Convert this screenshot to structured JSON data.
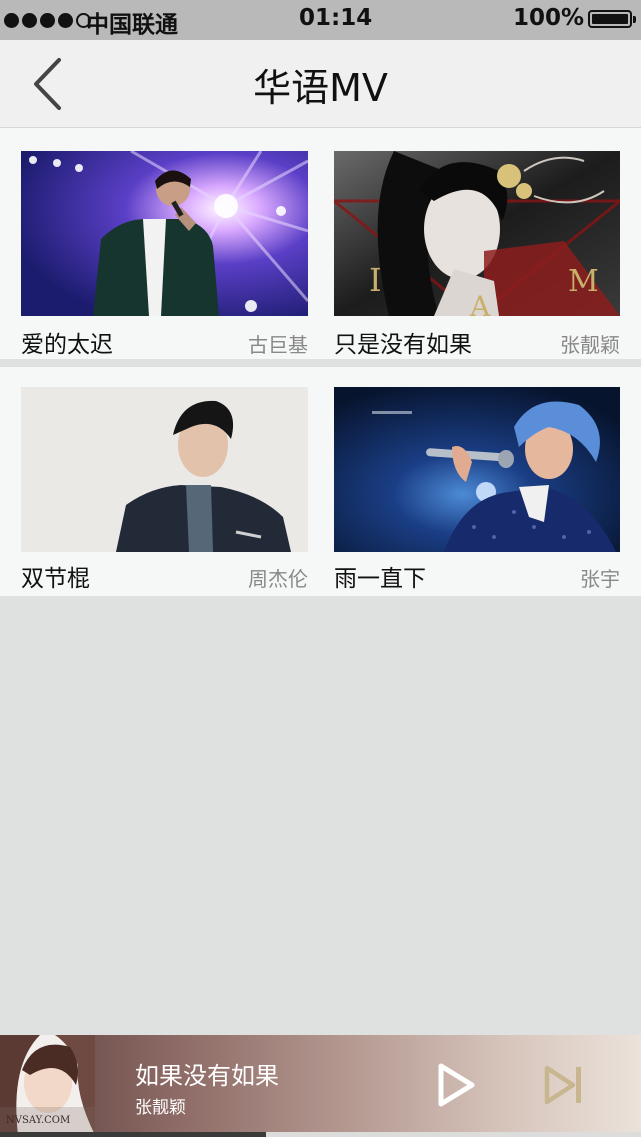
{
  "status_bar": {
    "carrier": "中国联通",
    "time": "01:14",
    "battery_percent": "100%",
    "signal_bars_filled": 4,
    "signal_bars_total": 5
  },
  "nav": {
    "title": "华语MV",
    "back_icon": "chevron-left-icon"
  },
  "videos": [
    {
      "title": "爱的太迟",
      "artist": "古巨基"
    },
    {
      "title": "只是没有如果",
      "artist": "张靓颖"
    },
    {
      "title": "双节棍",
      "artist": "周杰伦"
    },
    {
      "title": "雨一直下",
      "artist": "张宇"
    }
  ],
  "album_art_text": {
    "iam": [
      "I",
      "A",
      "M"
    ],
    "cover_watermark": "NVSAY.COM"
  },
  "player": {
    "title": "如果没有如果",
    "artist": "张靓颖",
    "progress": 0.415,
    "play_icon": "play-icon",
    "next_icon": "skip-next-icon"
  },
  "colors": {
    "status_bar_bg": "#b9b9b9",
    "nav_bg": "#f0f0f0",
    "page_bg": "#dfe0e0",
    "player_icon": "#c7b68e"
  }
}
